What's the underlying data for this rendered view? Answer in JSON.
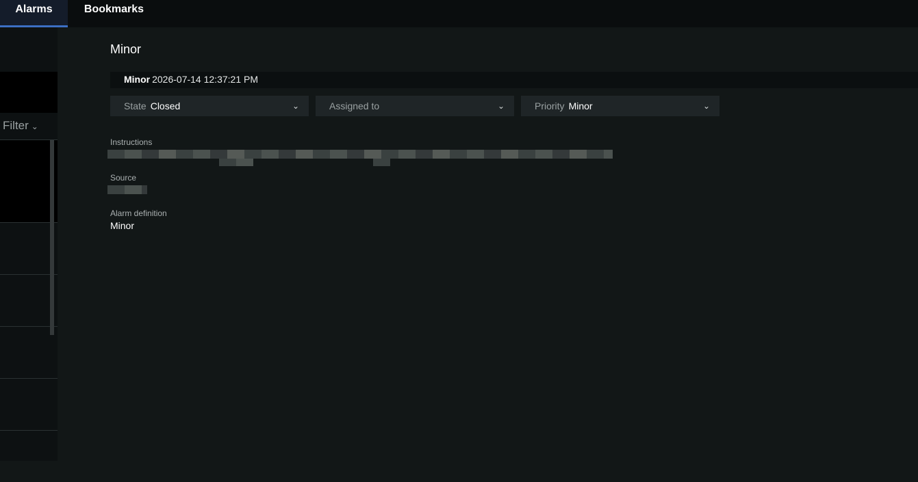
{
  "tabs": {
    "alarms": "Alarms",
    "bookmarks": "Bookmarks"
  },
  "left": {
    "filter_label": "Filter"
  },
  "detail": {
    "title": "Minor",
    "event": {
      "name": "Minor",
      "timestamp": "2026-07-14 12:37:21 PM"
    },
    "state": {
      "label": "State",
      "value": "Closed"
    },
    "assigned": {
      "label": "Assigned to",
      "value": ""
    },
    "priority": {
      "label": "Priority",
      "value": "Minor"
    },
    "instructions_label": "Instructions",
    "source_label": "Source",
    "alarm_definition_label": "Alarm definition",
    "alarm_definition_value": "Minor"
  },
  "colors": {
    "accent": "#3c6fc4",
    "background": "#121717",
    "topbar": "#0a0d0e",
    "dropdown": "#1f2527"
  }
}
